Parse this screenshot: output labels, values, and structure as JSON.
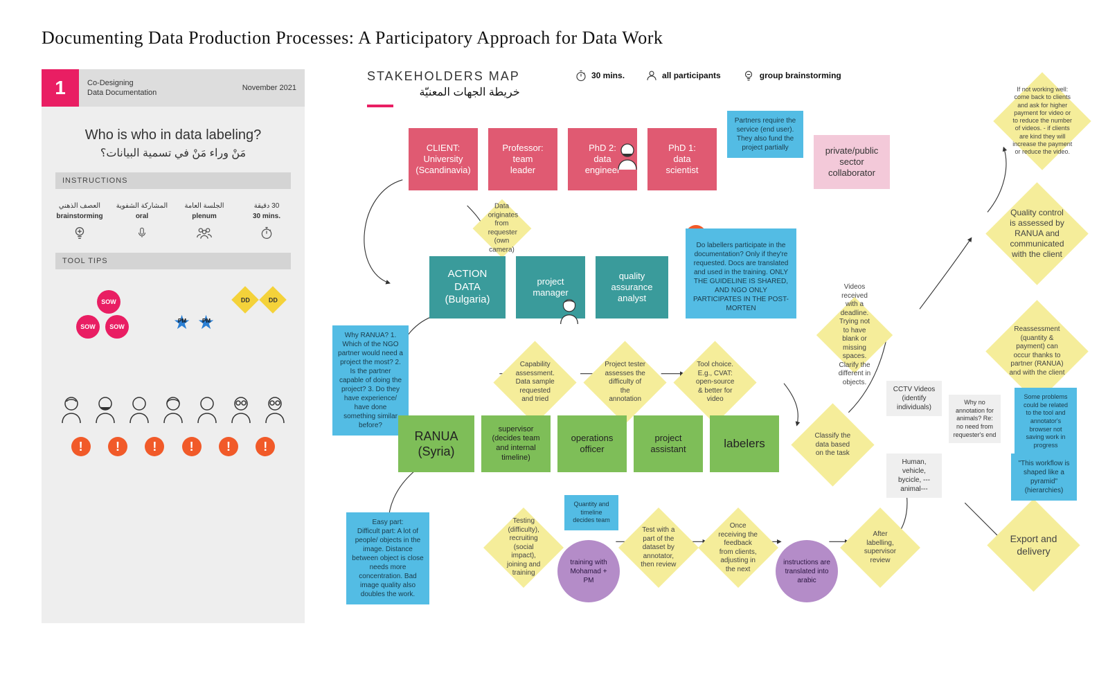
{
  "title": "Documenting Data Production Processes: A Participatory Approach for Data Work",
  "left": {
    "number": "1",
    "subtitle1": "Co-Designing",
    "subtitle2": "Data Documentation",
    "date": "November 2021",
    "question_en": "Who is who in data labeling?",
    "question_ar": "مَنْ وراء مَنْ في تسمية البيانات؟",
    "bar_instr": "INSTRUCTIONS",
    "bar_tips": "TOOL TIPS",
    "modes": [
      {
        "ar": "العصف الذهني",
        "en": "brainstorming"
      },
      {
        "ar": "المشاركة الشفوية",
        "en": "oral"
      },
      {
        "ar": "الجلسة العامة",
        "en": "plenum"
      },
      {
        "ar": "30 دقيقة",
        "en": "30 mins."
      }
    ],
    "sow": "SOW",
    "dd": "DD",
    "pm": "PM"
  },
  "header": {
    "title": "STAKEHOLDERS MAP",
    "title_ar": "خريطة الجهات المعنيّة",
    "leg_time": "30 mins.",
    "leg_part": "all participants",
    "leg_mode": "group brainstorming"
  },
  "cards": {
    "client": "CLIENT:\nUniversity\n(Scandinavia)",
    "prof": "Professor:\nteam\nleader",
    "phd2": "PhD 2:\ndata\nengineer",
    "phd1": "PhD 1:\ndata\nscientist",
    "collab": "private/public\nsector\ncollaborator",
    "action": "ACTION\nDATA\n(Bulgaria)",
    "pm": "project\nmanager",
    "qa": "quality\nassurance\nanalyst",
    "ranua": "RANUA\n(Syria)",
    "sup": "supervisor\n(decides team\nand internal\ntimeline)",
    "ops": "operations\nofficer",
    "pa": "project\nassistant",
    "lab": "labelers"
  },
  "notes": {
    "partners": "Partners require the service (end user). They also fund the project partially",
    "docparticip": "Do labellers participate in the documentation? Only if they're requested. Docs are translated and used in the training. ONLY THE GUIDELINE IS SHARED, AND NGO ONLY PARTICIPATES IN THE POST-MORTEN",
    "whyranua": "Why RANUA? 1. Which of the NGO partner would need a project the most? 2. Is the partner capable of doing the project? 3. Do they have experience/ have done something similar before?",
    "easy": "Easy part:\nDifficult part: A lot of people/ objects in the image. Distance between object is close needs more concentration. Bad image quality also doubles the work.",
    "quantity": "Quantity and timeline decides team",
    "problems": "Some problems could be related to the tool and annotator's browser not saving work in progress",
    "pyramid": "\"This workflow is shaped like a pyramid\" (hierarchies)"
  },
  "diamonds": {
    "origin": "Data originates from requester (own camera)",
    "notworking": "If not working well: come back to clients and ask for higher payment for video or to reduce the number of videos. - if clients are kind they will increase the payment or reduce the video.",
    "qcranua": "Quality control is assessed by RANUA and communicated with the client",
    "reassess": "Reassessment (quantity & payment) can occur thanks to partner (RANUA) and with the client",
    "capab": "Capability assessment. Data sample requested and tried",
    "tester": "Project tester assesses the difficulty of the annotation",
    "tool": "Tool choice. E.g., CVAT: open-source & better for video",
    "classify": "Classify the data based on the task",
    "videos": "Videos received with a deadline. Trying not to have blank or missing spaces. Clarify the different in objects.",
    "testing": "Testing (difficulty), recruiting (social impact), joining and training",
    "testpart": "Test with a part of the dataset by annotator, then review",
    "feedback": "Once receiving the feedback from clients, adjusting in the next",
    "after": "After labelling, supervisor review",
    "export": "Export and delivery"
  },
  "purples": {
    "training": "training with Mohamad + PM",
    "instr": "instructions are translated into arabic"
  },
  "gboxes": {
    "cctv": "CCTV Videos (identify individuals)",
    "noanim": "Why no annotation for animals? Re: no need from requester's end",
    "human": "Human, vehicle, bycicle, --- animal---"
  }
}
